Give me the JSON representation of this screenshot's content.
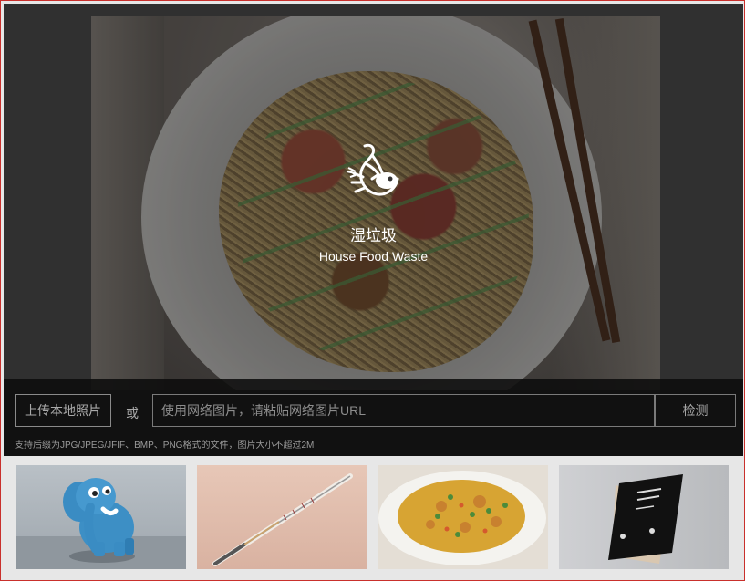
{
  "result": {
    "category_cn": "湿垃圾",
    "category_en": "House Food Waste",
    "icon": "food-waste-fishbone-icon"
  },
  "upload": {
    "upload_label": "上传本地照片",
    "or_label": "或",
    "url_placeholder": "使用网络图片，请粘贴网络图片URL",
    "url_value": "",
    "detect_label": "检测",
    "hint": "支持后缀为JPG/JPEG/JFIF、BMP、PNG格式的文件，图片大小不超过2M"
  },
  "samples": [
    {
      "name": "blue-clay-elephant"
    },
    {
      "name": "clinical-thermometer"
    },
    {
      "name": "fried-rice-plate"
    },
    {
      "name": "black-book"
    }
  ],
  "colors": {
    "border": "#c9302c",
    "bar_bg": "#0c0c0c",
    "text_muted": "#a9a9a9"
  }
}
